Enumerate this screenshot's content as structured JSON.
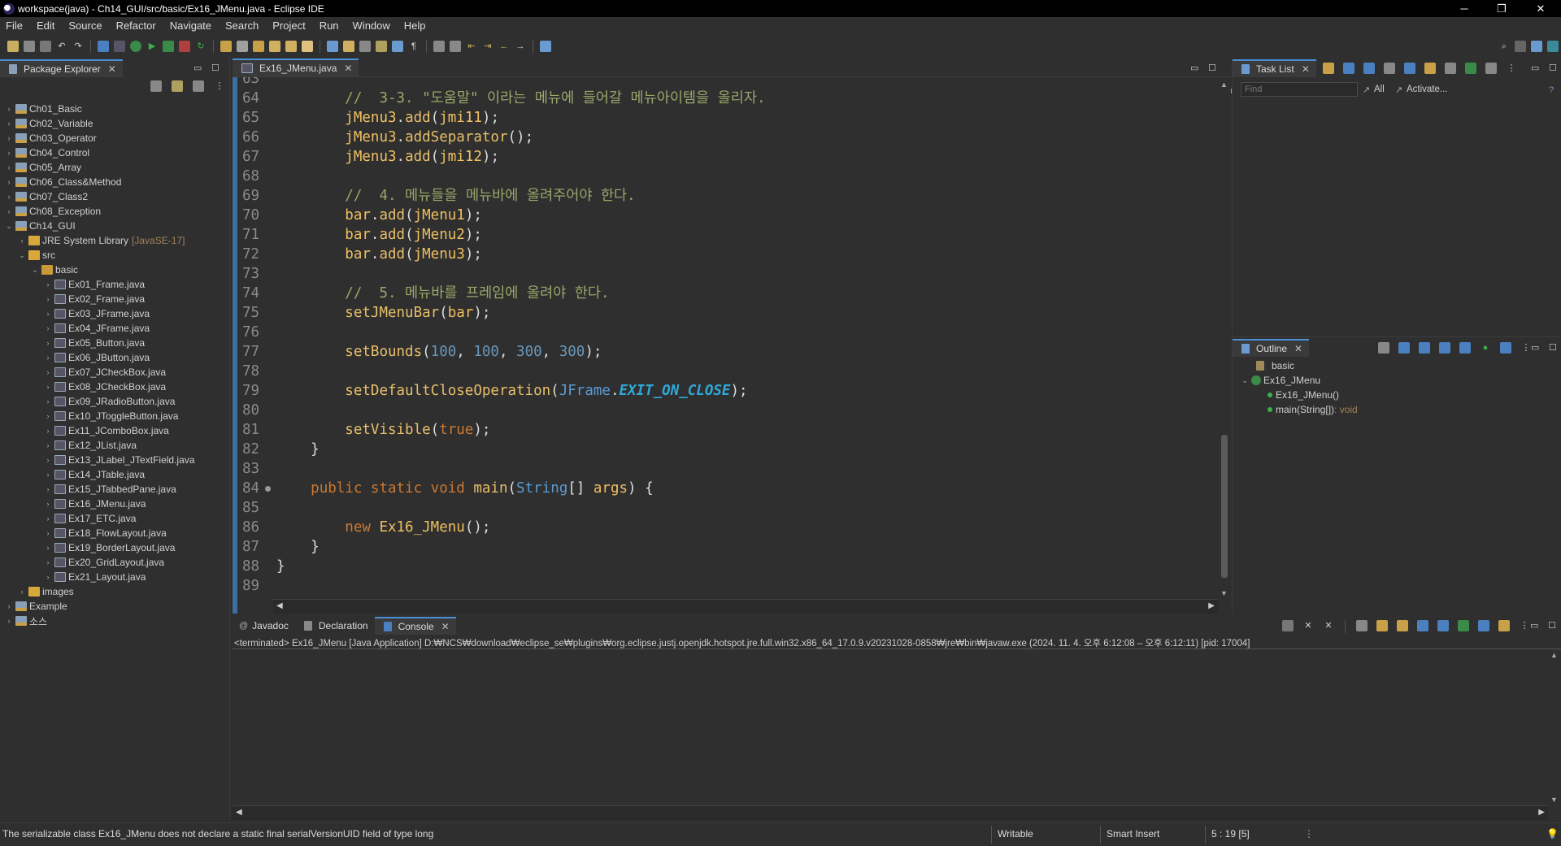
{
  "window": {
    "title": "workspace(java) - Ch14_GUI/src/basic/Ex16_JMenu.java - Eclipse IDE",
    "controls": [
      "─",
      "❐",
      "✕"
    ]
  },
  "menubar": [
    "File",
    "Edit",
    "Source",
    "Refactor",
    "Navigate",
    "Search",
    "Project",
    "Run",
    "Window",
    "Help"
  ],
  "package_explorer": {
    "title": "Package Explorer",
    "items": [
      {
        "label": "Ch01_Basic",
        "indent": 0,
        "expanded": false,
        "kind": "project"
      },
      {
        "label": "Ch02_Variable",
        "indent": 0,
        "expanded": false,
        "kind": "project"
      },
      {
        "label": "Ch03_Operator",
        "indent": 0,
        "expanded": false,
        "kind": "project"
      },
      {
        "label": "Ch04_Control",
        "indent": 0,
        "expanded": false,
        "kind": "project"
      },
      {
        "label": "Ch05_Array",
        "indent": 0,
        "expanded": false,
        "kind": "project"
      },
      {
        "label": "Ch06_Class&Method",
        "indent": 0,
        "expanded": false,
        "kind": "project"
      },
      {
        "label": "Ch07_Class2",
        "indent": 0,
        "expanded": false,
        "kind": "project"
      },
      {
        "label": "Ch08_Exception",
        "indent": 0,
        "expanded": false,
        "kind": "project"
      },
      {
        "label": "Ch14_GUI",
        "indent": 0,
        "expanded": true,
        "kind": "project"
      },
      {
        "label": "JRE System Library",
        "deco": "[JavaSE-17]",
        "indent": 1,
        "expanded": false,
        "kind": "library"
      },
      {
        "label": "src",
        "indent": 1,
        "expanded": true,
        "kind": "folder"
      },
      {
        "label": "basic",
        "indent": 2,
        "expanded": true,
        "kind": "package"
      },
      {
        "label": "Ex01_Frame.java",
        "indent": 3,
        "expanded": false,
        "kind": "java"
      },
      {
        "label": "Ex02_Frame.java",
        "indent": 3,
        "expanded": false,
        "kind": "java"
      },
      {
        "label": "Ex03_JFrame.java",
        "indent": 3,
        "expanded": false,
        "kind": "java"
      },
      {
        "label": "Ex04_JFrame.java",
        "indent": 3,
        "expanded": false,
        "kind": "java"
      },
      {
        "label": "Ex05_Button.java",
        "indent": 3,
        "expanded": false,
        "kind": "java"
      },
      {
        "label": "Ex06_JButton.java",
        "indent": 3,
        "expanded": false,
        "kind": "java"
      },
      {
        "label": "Ex07_JCheckBox.java",
        "indent": 3,
        "expanded": false,
        "kind": "java"
      },
      {
        "label": "Ex08_JCheckBox.java",
        "indent": 3,
        "expanded": false,
        "kind": "java"
      },
      {
        "label": "Ex09_JRadioButton.java",
        "indent": 3,
        "expanded": false,
        "kind": "java"
      },
      {
        "label": "Ex10_JToggleButton.java",
        "indent": 3,
        "expanded": false,
        "kind": "java"
      },
      {
        "label": "Ex11_JComboBox.java",
        "indent": 3,
        "expanded": false,
        "kind": "java"
      },
      {
        "label": "Ex12_JList.java",
        "indent": 3,
        "expanded": false,
        "kind": "java"
      },
      {
        "label": "Ex13_JLabel_JTextField.java",
        "indent": 3,
        "expanded": false,
        "kind": "java"
      },
      {
        "label": "Ex14_JTable.java",
        "indent": 3,
        "expanded": false,
        "kind": "java"
      },
      {
        "label": "Ex15_JTabbedPane.java",
        "indent": 3,
        "expanded": false,
        "kind": "java"
      },
      {
        "label": "Ex16_JMenu.java",
        "indent": 3,
        "expanded": false,
        "kind": "java"
      },
      {
        "label": "Ex17_ETC.java",
        "indent": 3,
        "expanded": false,
        "kind": "java"
      },
      {
        "label": "Ex18_FlowLayout.java",
        "indent": 3,
        "expanded": false,
        "kind": "java"
      },
      {
        "label": "Ex19_BorderLayout.java",
        "indent": 3,
        "expanded": false,
        "kind": "java"
      },
      {
        "label": "Ex20_GridLayout.java",
        "indent": 3,
        "expanded": false,
        "kind": "java"
      },
      {
        "label": "Ex21_Layout.java",
        "indent": 3,
        "expanded": false,
        "kind": "java"
      },
      {
        "label": "images",
        "indent": 1,
        "expanded": false,
        "kind": "folder"
      },
      {
        "label": "Example",
        "indent": 0,
        "expanded": false,
        "kind": "project"
      },
      {
        "label": "소스",
        "indent": 0,
        "expanded": false,
        "kind": "project"
      }
    ]
  },
  "editor": {
    "tab_label": "Ex16_JMenu.java",
    "lines": [
      {
        "n": "63",
        "tokens": []
      },
      {
        "n": "64",
        "tokens": [
          [
            "        ",
            "pun"
          ],
          [
            "//  3-3. \"도움말\" 이라는 메뉴에 들어갈 메뉴아이템을 올리자.",
            "cm"
          ]
        ]
      },
      {
        "n": "65",
        "tokens": [
          [
            "        ",
            "pun"
          ],
          [
            "jMenu3",
            "id"
          ],
          [
            ".",
            "pun"
          ],
          [
            "add",
            "mth"
          ],
          [
            "(",
            "pun"
          ],
          [
            "jmi11",
            "id"
          ],
          [
            ");",
            "pun"
          ]
        ]
      },
      {
        "n": "66",
        "tokens": [
          [
            "        ",
            "pun"
          ],
          [
            "jMenu3",
            "id"
          ],
          [
            ".",
            "pun"
          ],
          [
            "addSeparator",
            "mth"
          ],
          [
            "();",
            "pun"
          ]
        ]
      },
      {
        "n": "67",
        "tokens": [
          [
            "        ",
            "pun"
          ],
          [
            "jMenu3",
            "id"
          ],
          [
            ".",
            "pun"
          ],
          [
            "add",
            "mth"
          ],
          [
            "(",
            "pun"
          ],
          [
            "jmi12",
            "id"
          ],
          [
            ");",
            "pun"
          ]
        ]
      },
      {
        "n": "68",
        "tokens": []
      },
      {
        "n": "69",
        "tokens": [
          [
            "        ",
            "pun"
          ],
          [
            "//  4. 메뉴들을 메뉴바에 올려주어야 한다.",
            "cm"
          ]
        ]
      },
      {
        "n": "70",
        "tokens": [
          [
            "        ",
            "pun"
          ],
          [
            "bar",
            "id"
          ],
          [
            ".",
            "pun"
          ],
          [
            "add",
            "mth"
          ],
          [
            "(",
            "pun"
          ],
          [
            "jMenu1",
            "id"
          ],
          [
            ");",
            "pun"
          ]
        ]
      },
      {
        "n": "71",
        "tokens": [
          [
            "        ",
            "pun"
          ],
          [
            "bar",
            "id"
          ],
          [
            ".",
            "pun"
          ],
          [
            "add",
            "mth"
          ],
          [
            "(",
            "pun"
          ],
          [
            "jMenu2",
            "id"
          ],
          [
            ");",
            "pun"
          ]
        ]
      },
      {
        "n": "72",
        "tokens": [
          [
            "        ",
            "pun"
          ],
          [
            "bar",
            "id"
          ],
          [
            ".",
            "pun"
          ],
          [
            "add",
            "mth"
          ],
          [
            "(",
            "pun"
          ],
          [
            "jMenu3",
            "id"
          ],
          [
            ");",
            "pun"
          ]
        ]
      },
      {
        "n": "73",
        "tokens": []
      },
      {
        "n": "74",
        "tokens": [
          [
            "        ",
            "pun"
          ],
          [
            "//  5. 메뉴바를 프레임에 올려야 한다.",
            "cm"
          ]
        ]
      },
      {
        "n": "75",
        "tokens": [
          [
            "        ",
            "pun"
          ],
          [
            "setJMenuBar",
            "mth"
          ],
          [
            "(",
            "pun"
          ],
          [
            "bar",
            "id"
          ],
          [
            ");",
            "pun"
          ]
        ]
      },
      {
        "n": "76",
        "tokens": []
      },
      {
        "n": "77",
        "tokens": [
          [
            "        ",
            "pun"
          ],
          [
            "setBounds",
            "mth"
          ],
          [
            "(",
            "pun"
          ],
          [
            "100",
            "num"
          ],
          [
            ", ",
            "pun"
          ],
          [
            "100",
            "num"
          ],
          [
            ", ",
            "pun"
          ],
          [
            "300",
            "num"
          ],
          [
            ", ",
            "pun"
          ],
          [
            "300",
            "num"
          ],
          [
            ");",
            "pun"
          ]
        ]
      },
      {
        "n": "78",
        "tokens": []
      },
      {
        "n": "79",
        "tokens": [
          [
            "        ",
            "pun"
          ],
          [
            "setDefaultCloseOperation",
            "mth"
          ],
          [
            "(",
            "pun"
          ],
          [
            "JFrame",
            "typ"
          ],
          [
            ".",
            "pun"
          ],
          [
            "EXIT_ON_CLOSE",
            "const"
          ],
          [
            ");",
            "pun"
          ]
        ]
      },
      {
        "n": "80",
        "tokens": []
      },
      {
        "n": "81",
        "tokens": [
          [
            "        ",
            "pun"
          ],
          [
            "setVisible",
            "mth"
          ],
          [
            "(",
            "pun"
          ],
          [
            "true",
            "kw"
          ],
          [
            ");",
            "pun"
          ]
        ]
      },
      {
        "n": "82",
        "tokens": [
          [
            "    ",
            "pun"
          ],
          [
            "}",
            "pun"
          ]
        ]
      },
      {
        "n": "83",
        "tokens": []
      },
      {
        "n": "84",
        "tokens": [
          [
            "    ",
            "pun"
          ],
          [
            "public static void ",
            "kw"
          ],
          [
            "main",
            "mth"
          ],
          [
            "(",
            "pun"
          ],
          [
            "String",
            "typ"
          ],
          [
            "[] ",
            "pun"
          ],
          [
            "args",
            "id"
          ],
          [
            ") {",
            "pun"
          ]
        ]
      },
      {
        "n": "85",
        "tokens": []
      },
      {
        "n": "86",
        "tokens": [
          [
            "        ",
            "pun"
          ],
          [
            "new ",
            "kw"
          ],
          [
            "Ex16_JMenu",
            "id"
          ],
          [
            "();",
            "pun"
          ]
        ]
      },
      {
        "n": "87",
        "tokens": [
          [
            "    ",
            "pun"
          ],
          [
            "}",
            "pun"
          ]
        ]
      },
      {
        "n": "88",
        "tokens": [
          [
            "}",
            "pun"
          ]
        ]
      },
      {
        "n": "89",
        "tokens": []
      }
    ],
    "fold_marker_line": "84"
  },
  "task_list": {
    "title": "Task List",
    "find_placeholder": "Find",
    "all_label": "All",
    "activate_label": "Activate..."
  },
  "outline": {
    "title": "Outline",
    "items": [
      {
        "label": "basic",
        "indent": 0
      },
      {
        "label": "Ex16_JMenu",
        "indent": 0
      },
      {
        "label": "Ex16_JMenu()",
        "indent": 1
      },
      {
        "label": "main(String[])",
        "suffix": " : void",
        "indent": 1
      }
    ]
  },
  "bottom_tabs": [
    "Javadoc",
    "Declaration",
    "Console"
  ],
  "console": {
    "header": "<terminated> Ex16_JMenu [Java Application] D:₩NCS₩download₩eclipse_se₩plugins₩org.eclipse.justj.openjdk.hotspot.jre.full.win32.x86_64_17.0.9.v20231028-0858₩jre₩bin₩javaw.exe  (2024. 11. 4. 오후 6:12:08 – 오후 6:12:11) [pid: 17004]"
  },
  "statusbar": {
    "message": "The serializable class Ex16_JMenu does not declare a static final serialVersionUID field of type long",
    "writable": "Writable",
    "insert_mode": "Smart Insert",
    "position": "5 : 19 [5]"
  }
}
